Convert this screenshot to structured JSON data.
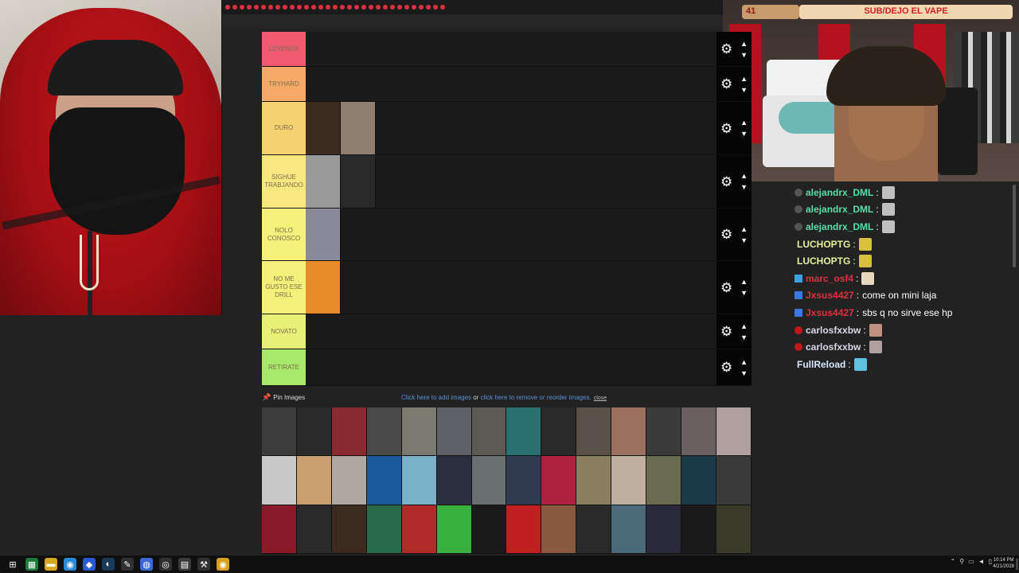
{
  "webcam_overlay": {
    "count": "41",
    "title": "SUB/DEJO EL VAPE"
  },
  "tiers": [
    {
      "label": "LEYENDA",
      "color": "#f05a70",
      "images": []
    },
    {
      "label": "TRYHARD",
      "color": "#f7a968",
      "images": []
    },
    {
      "label": "DURO",
      "color": "#f7d070",
      "images": [
        "#3a2a20",
        "#8f7f70"
      ]
    },
    {
      "label": "SIGHUE TRABJANDO",
      "color": "#f9e880",
      "images": [
        "#9a9a9a",
        "#2a2a2a"
      ]
    },
    {
      "label": "NOLO CONOSCO",
      "color": "#f7f07a",
      "images": [
        "#8a8a9a"
      ]
    },
    {
      "label": "NO ME GUSTO ESE DRILL",
      "color": "#f4f07a",
      "images": [
        "#e88a2a"
      ]
    },
    {
      "label": "NOVATO",
      "color": "#e8f078",
      "images": []
    },
    {
      "label": "RETIRATE",
      "color": "#a8e86a",
      "images": []
    }
  ],
  "pin_images": "Pin Images",
  "pool_links": {
    "add": "Click here to add images",
    "or": " or ",
    "remove": "click here to remove or reorder images.",
    "close": "close"
  },
  "pool_colors": [
    "#3c3c3c",
    "#2a2a2a",
    "#8a2a30",
    "#4a4a4a",
    "#7a7a70",
    "#606068",
    "#5c5a55",
    "#2a7070",
    "#2a2a2a",
    "#5a5048",
    "#9a7060",
    "#3a3a3a",
    "#6a6060",
    "#b0a0a0",
    "#c8c8c8",
    "#caa070",
    "#b0a8a0",
    "#1a5a9a",
    "#7ab0c8",
    "#2a3040",
    "#6a7070",
    "#303a50",
    "#b02040",
    "#8a8060",
    "#c0b0a0",
    "#6a6a50",
    "#1a3a4a",
    "#3a3a3a",
    "#8a1a2a",
    "#2a2a2a",
    "#3a2a20",
    "#2a6a4a",
    "#b02a2a",
    "#3ab040",
    "#1a1a1a",
    "#c02020",
    "#8a5a40",
    "#2a2a2a",
    "#4a6a7a",
    "#2a2a3a",
    "#1a1a1a",
    "#3a3a2a"
  ],
  "chat": [
    {
      "user": "alejandrx_DML",
      "color": "#55e0a8",
      "badge": "circle",
      "badge_color": "#555555",
      "sep": " :",
      "text": "",
      "emote": "#c0c0c0"
    },
    {
      "user": "alejandrx_DML",
      "color": "#55e0a8",
      "badge": "circle",
      "badge_color": "#555555",
      "sep": " :",
      "text": "",
      "emote": "#c0c0c0"
    },
    {
      "user": "alejandrx_DML",
      "color": "#55e0a8",
      "badge": "circle",
      "badge_color": "#555555",
      "sep": " :",
      "text": "",
      "emote": "#c0c0c0"
    },
    {
      "user": "LUCHOPTG",
      "color": "#e8f0a0",
      "badge": "none",
      "badge_color": "",
      "sep": " :",
      "text": "",
      "emote": "#d8c040"
    },
    {
      "user": "LUCHOPTG",
      "color": "#e8f0a0",
      "badge": "none",
      "badge_color": "",
      "sep": " :",
      "text": "",
      "emote": "#d8c040"
    },
    {
      "user": "marc_osf4",
      "color": "#e03040",
      "badge": "square",
      "badge_color": "#3aa0e0",
      "sep": " :",
      "text": "",
      "emote": "#e8d8c0"
    },
    {
      "user": "Jxsus4427",
      "color": "#e03040",
      "badge": "square",
      "badge_color": "#3a7ae0",
      "sep": " :",
      "text": "come on mini laja",
      "emote": ""
    },
    {
      "user": "Jxsus4427",
      "color": "#e03040",
      "badge": "square",
      "badge_color": "#3a7ae0",
      "sep": " :",
      "text": "sbs q no sirve ese hp",
      "emote": ""
    },
    {
      "user": "carlosfxxbw",
      "color": "#d8d8e8",
      "badge": "circle",
      "badge_color": "#c01818",
      "sep": " :",
      "text": "",
      "emote": "#c09080"
    },
    {
      "user": "carlosfxxbw",
      "color": "#d8d8e8",
      "badge": "circle",
      "badge_color": "#c01818",
      "sep": " :",
      "text": "",
      "emote": "#b0a0a0"
    },
    {
      "user": "FullReload",
      "color": "#d8e8ff",
      "badge": "none",
      "badge_color": "",
      "sep": " :",
      "text": "",
      "emote": "#60c0e0"
    }
  ],
  "taskbar": {
    "icons": [
      {
        "name": "windows-start-icon",
        "glyph": "⊞",
        "bg": "#101010"
      },
      {
        "name": "spreadsheet-icon",
        "glyph": "▦",
        "bg": "#1a7a3a"
      },
      {
        "name": "folder-icon",
        "glyph": "▬",
        "bg": "#d8a820"
      },
      {
        "name": "chrome-icon",
        "glyph": "◉",
        "bg": "#2a8ad8"
      },
      {
        "name": "app-blue-icon",
        "glyph": "◆",
        "bg": "#2a5ad8"
      },
      {
        "name": "steam-icon",
        "glyph": "◐",
        "bg": "#1a3a5a"
      },
      {
        "name": "pen-icon",
        "glyph": "✎",
        "bg": "#303030"
      },
      {
        "name": "app-globe-icon",
        "glyph": "◍",
        "bg": "#3a6ad8"
      },
      {
        "name": "obs-icon",
        "glyph": "◎",
        "bg": "#303030"
      },
      {
        "name": "calendar-icon",
        "glyph": "▤",
        "bg": "#3a3a3a"
      },
      {
        "name": "tool-icon",
        "glyph": "⚒",
        "bg": "#303030"
      },
      {
        "name": "chrome-alt-icon",
        "glyph": "◉",
        "bg": "#d8a020"
      }
    ],
    "time": "10:14 PM",
    "date": "4/21/2028",
    "tray": [
      "⌃",
      "⚲",
      "▭",
      "◄",
      "▯"
    ]
  }
}
